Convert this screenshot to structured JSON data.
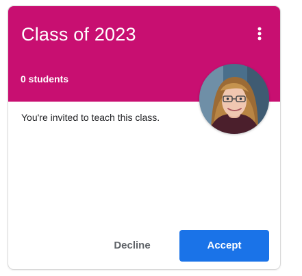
{
  "card": {
    "title": "Class of 2023",
    "student_count": "0 students",
    "invite_message": "You're invited to teach this class.",
    "more_icon": "vertical-dots-icon",
    "avatar": "teacher-profile-photo"
  },
  "actions": {
    "decline_label": "Decline",
    "accept_label": "Accept"
  },
  "colors": {
    "header": "#c80f71",
    "accept": "#1a73e8",
    "decline_text": "#5f6368"
  }
}
